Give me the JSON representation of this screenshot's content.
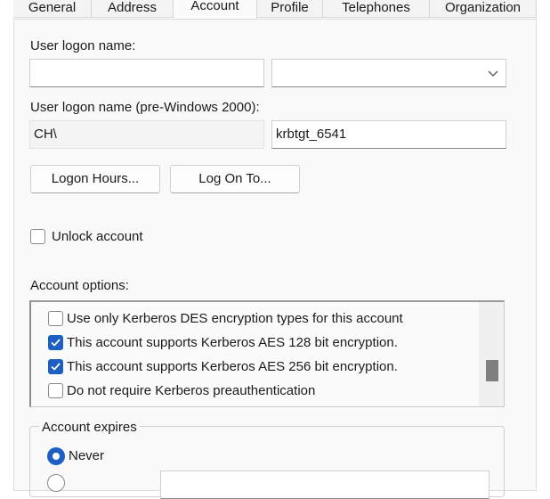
{
  "tabs": [
    {
      "label": "General"
    },
    {
      "label": "Address"
    },
    {
      "label": "Account",
      "active": true
    },
    {
      "label": "Profile"
    },
    {
      "label": "Telephones"
    },
    {
      "label": "Organization"
    }
  ],
  "logon": {
    "label": "User logon name:",
    "name_value": "",
    "suffix_value": ""
  },
  "pre2000": {
    "label": "User logon name (pre-Windows 2000):",
    "domain": "CH\\",
    "name": "krbtgt_6541"
  },
  "buttons": {
    "logon_hours": "Logon Hours...",
    "log_on_to": "Log On To..."
  },
  "unlock": {
    "label": "Unlock account",
    "checked": false
  },
  "account_options": {
    "label": "Account options:",
    "items": [
      {
        "label": "Use only Kerberos DES encryption types for this account",
        "checked": false
      },
      {
        "label": "This account supports Kerberos AES 128 bit encryption.",
        "checked": true
      },
      {
        "label": "This account supports Kerberos AES 256 bit encryption.",
        "checked": true
      },
      {
        "label": "Do not require Kerberos preauthentication",
        "checked": false
      }
    ]
  },
  "expires": {
    "label": "Account expires",
    "never_label": "Never",
    "selected": "Never"
  },
  "colors": {
    "accent": "#1e5fc4"
  }
}
